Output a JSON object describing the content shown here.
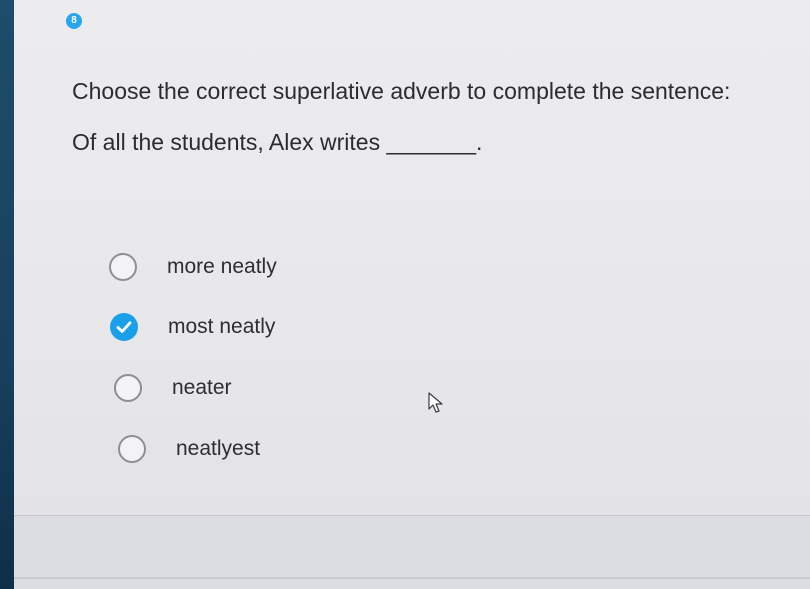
{
  "question": {
    "number": "8",
    "prompt": "Choose the correct superlative adverb to complete the sentence:",
    "sentence": "Of all the students, Alex writes _______."
  },
  "options": [
    {
      "label": "more neatly",
      "selected": false
    },
    {
      "label": "most neatly",
      "selected": true
    },
    {
      "label": "neater",
      "selected": false
    },
    {
      "label": "neatlyest",
      "selected": false
    }
  ],
  "colors": {
    "accent": "#1aa0ea",
    "sidebar": "#1f4c6c"
  },
  "icons": {
    "selected_radio": "check-icon",
    "pointer": "mouse-cursor-icon"
  }
}
